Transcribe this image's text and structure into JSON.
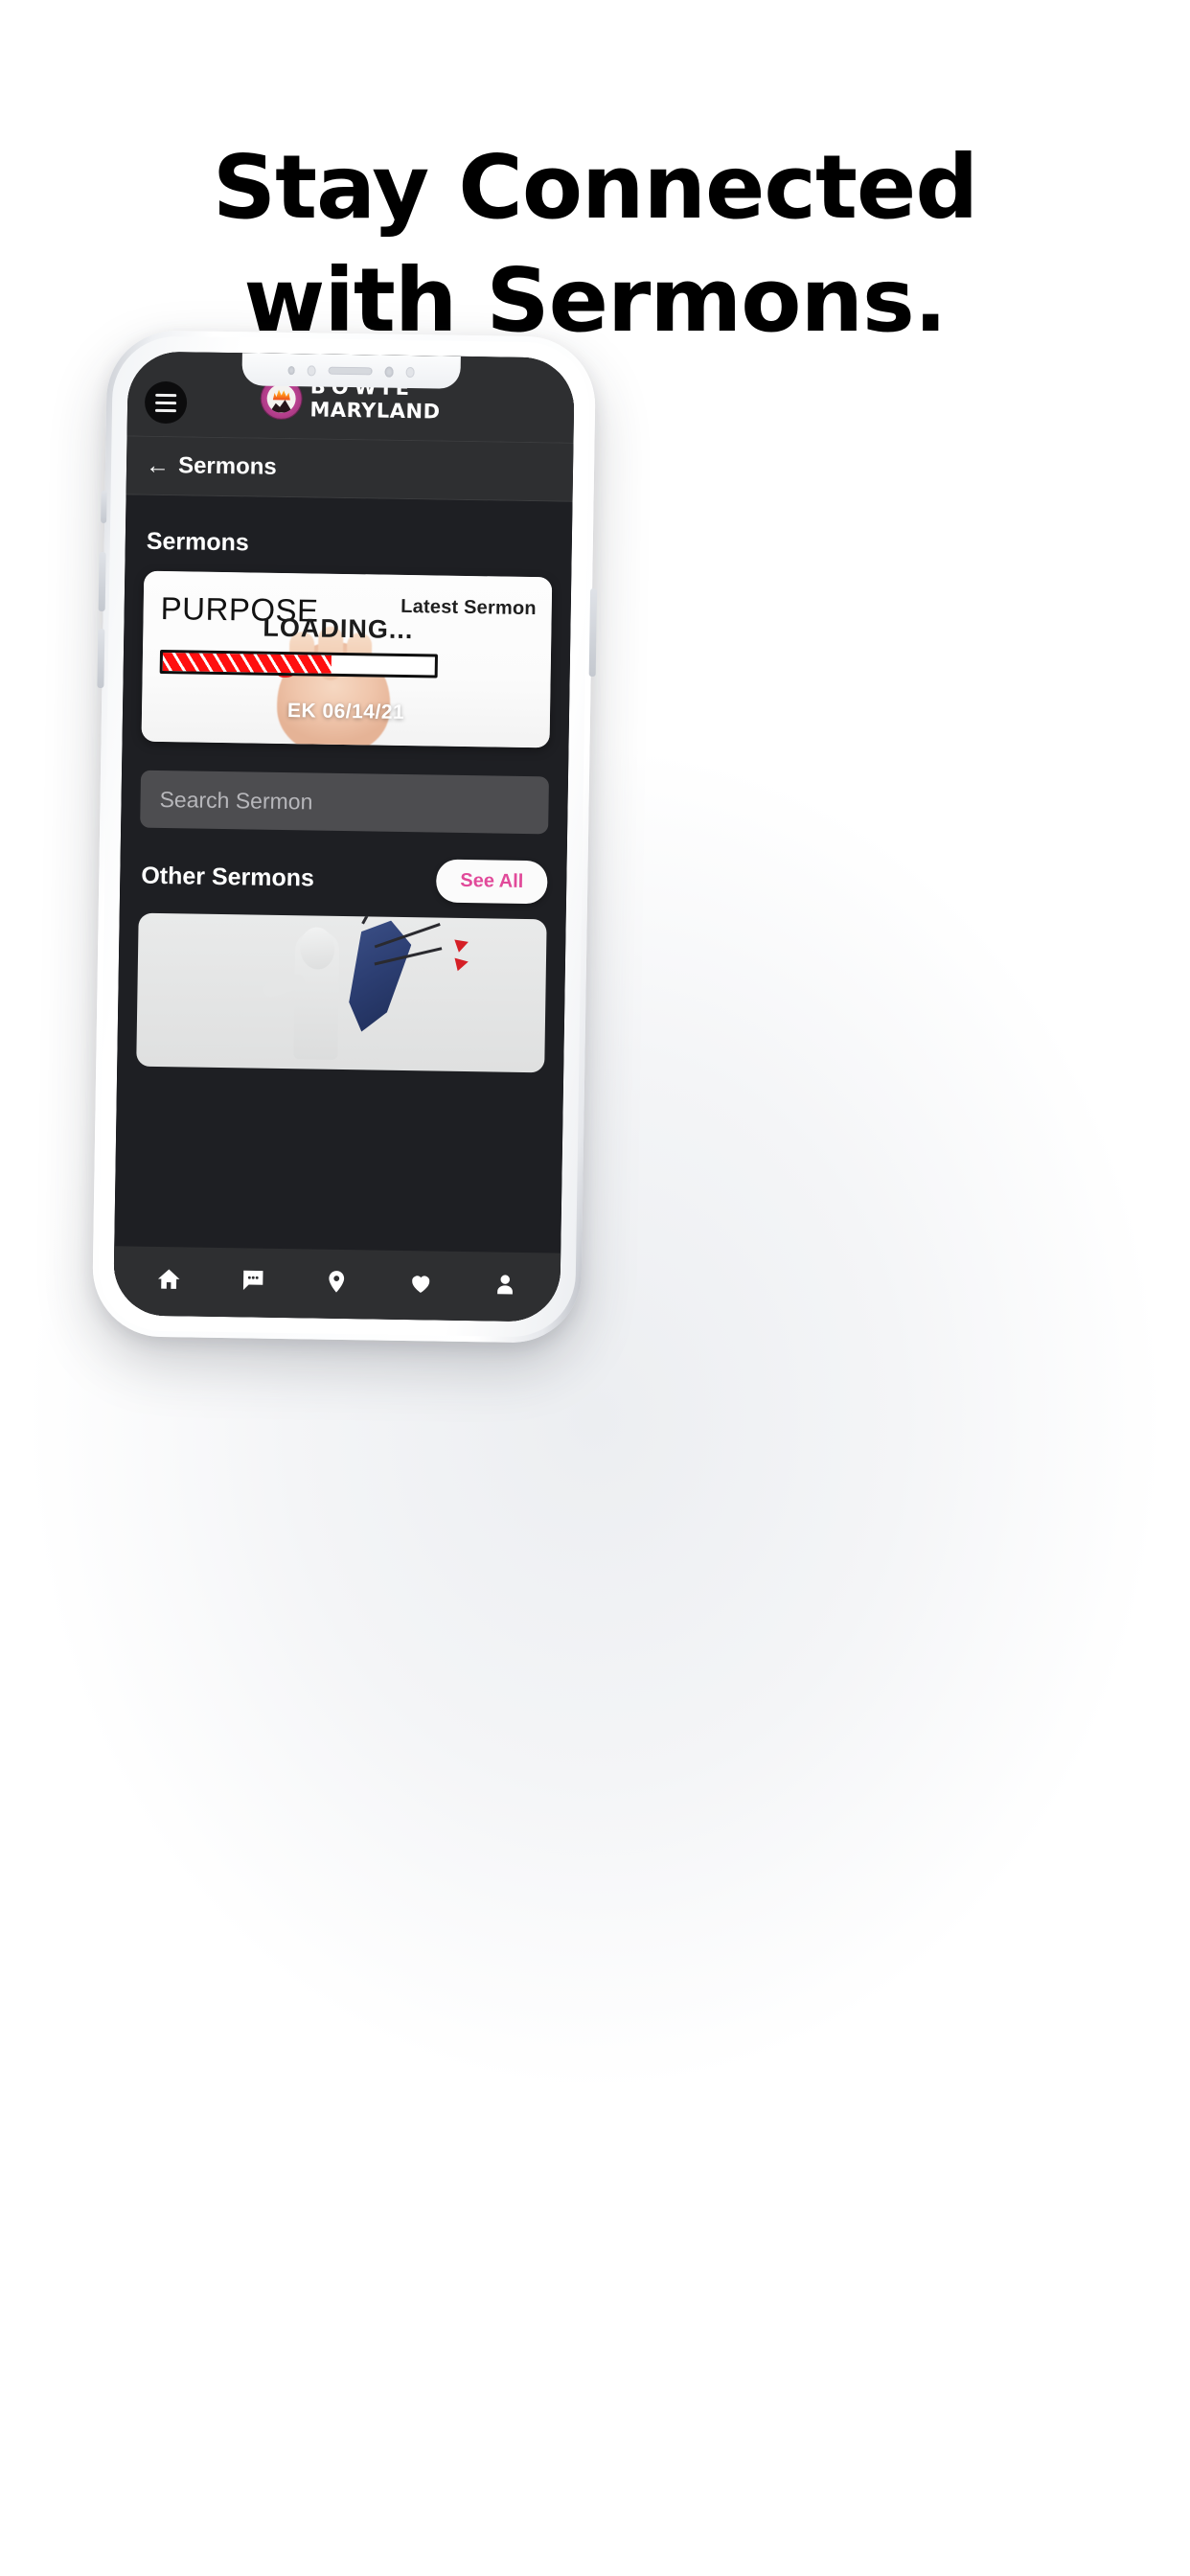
{
  "promo": {
    "headline_line1": "Stay Connected",
    "headline_line2": "with Sermons."
  },
  "app": {
    "header": {
      "menu_icon": "hamburger-menu-icon",
      "brand_line1": "BOWIE",
      "brand_line2": "MARYLAND",
      "logo_icon": "bowie-maryland-seal-icon"
    },
    "back_bar": {
      "arrow": "←",
      "label": "Sermons"
    },
    "sermons_section": {
      "title": "Sermons",
      "featured": {
        "artwork_word": "PURPOSE",
        "artwork_loading": "LOADING...",
        "badge_label": "Latest Sermon",
        "date_label": "EK 06/14/21",
        "progress_percent": 62
      },
      "search": {
        "value": "",
        "placeholder": "Search Sermon"
      },
      "other": {
        "title": "Other Sermons",
        "see_all_label": "See All",
        "thumb_alt": "shield-blocking-arrows-artwork"
      }
    },
    "tabbar": {
      "items": [
        {
          "name": "home",
          "icon": "home-icon"
        },
        {
          "name": "messages",
          "icon": "chat-bubble-icon"
        },
        {
          "name": "locations",
          "icon": "map-pin-icon"
        },
        {
          "name": "favorites",
          "icon": "heart-icon"
        },
        {
          "name": "profile",
          "icon": "person-icon"
        }
      ]
    }
  },
  "colors": {
    "accent_pink": "#e14a9a",
    "header_dark": "#2e2f31",
    "screen_dark": "#1e1f23",
    "progress_red": "#ff0f0f",
    "shield_blue": "#2c3e72"
  }
}
